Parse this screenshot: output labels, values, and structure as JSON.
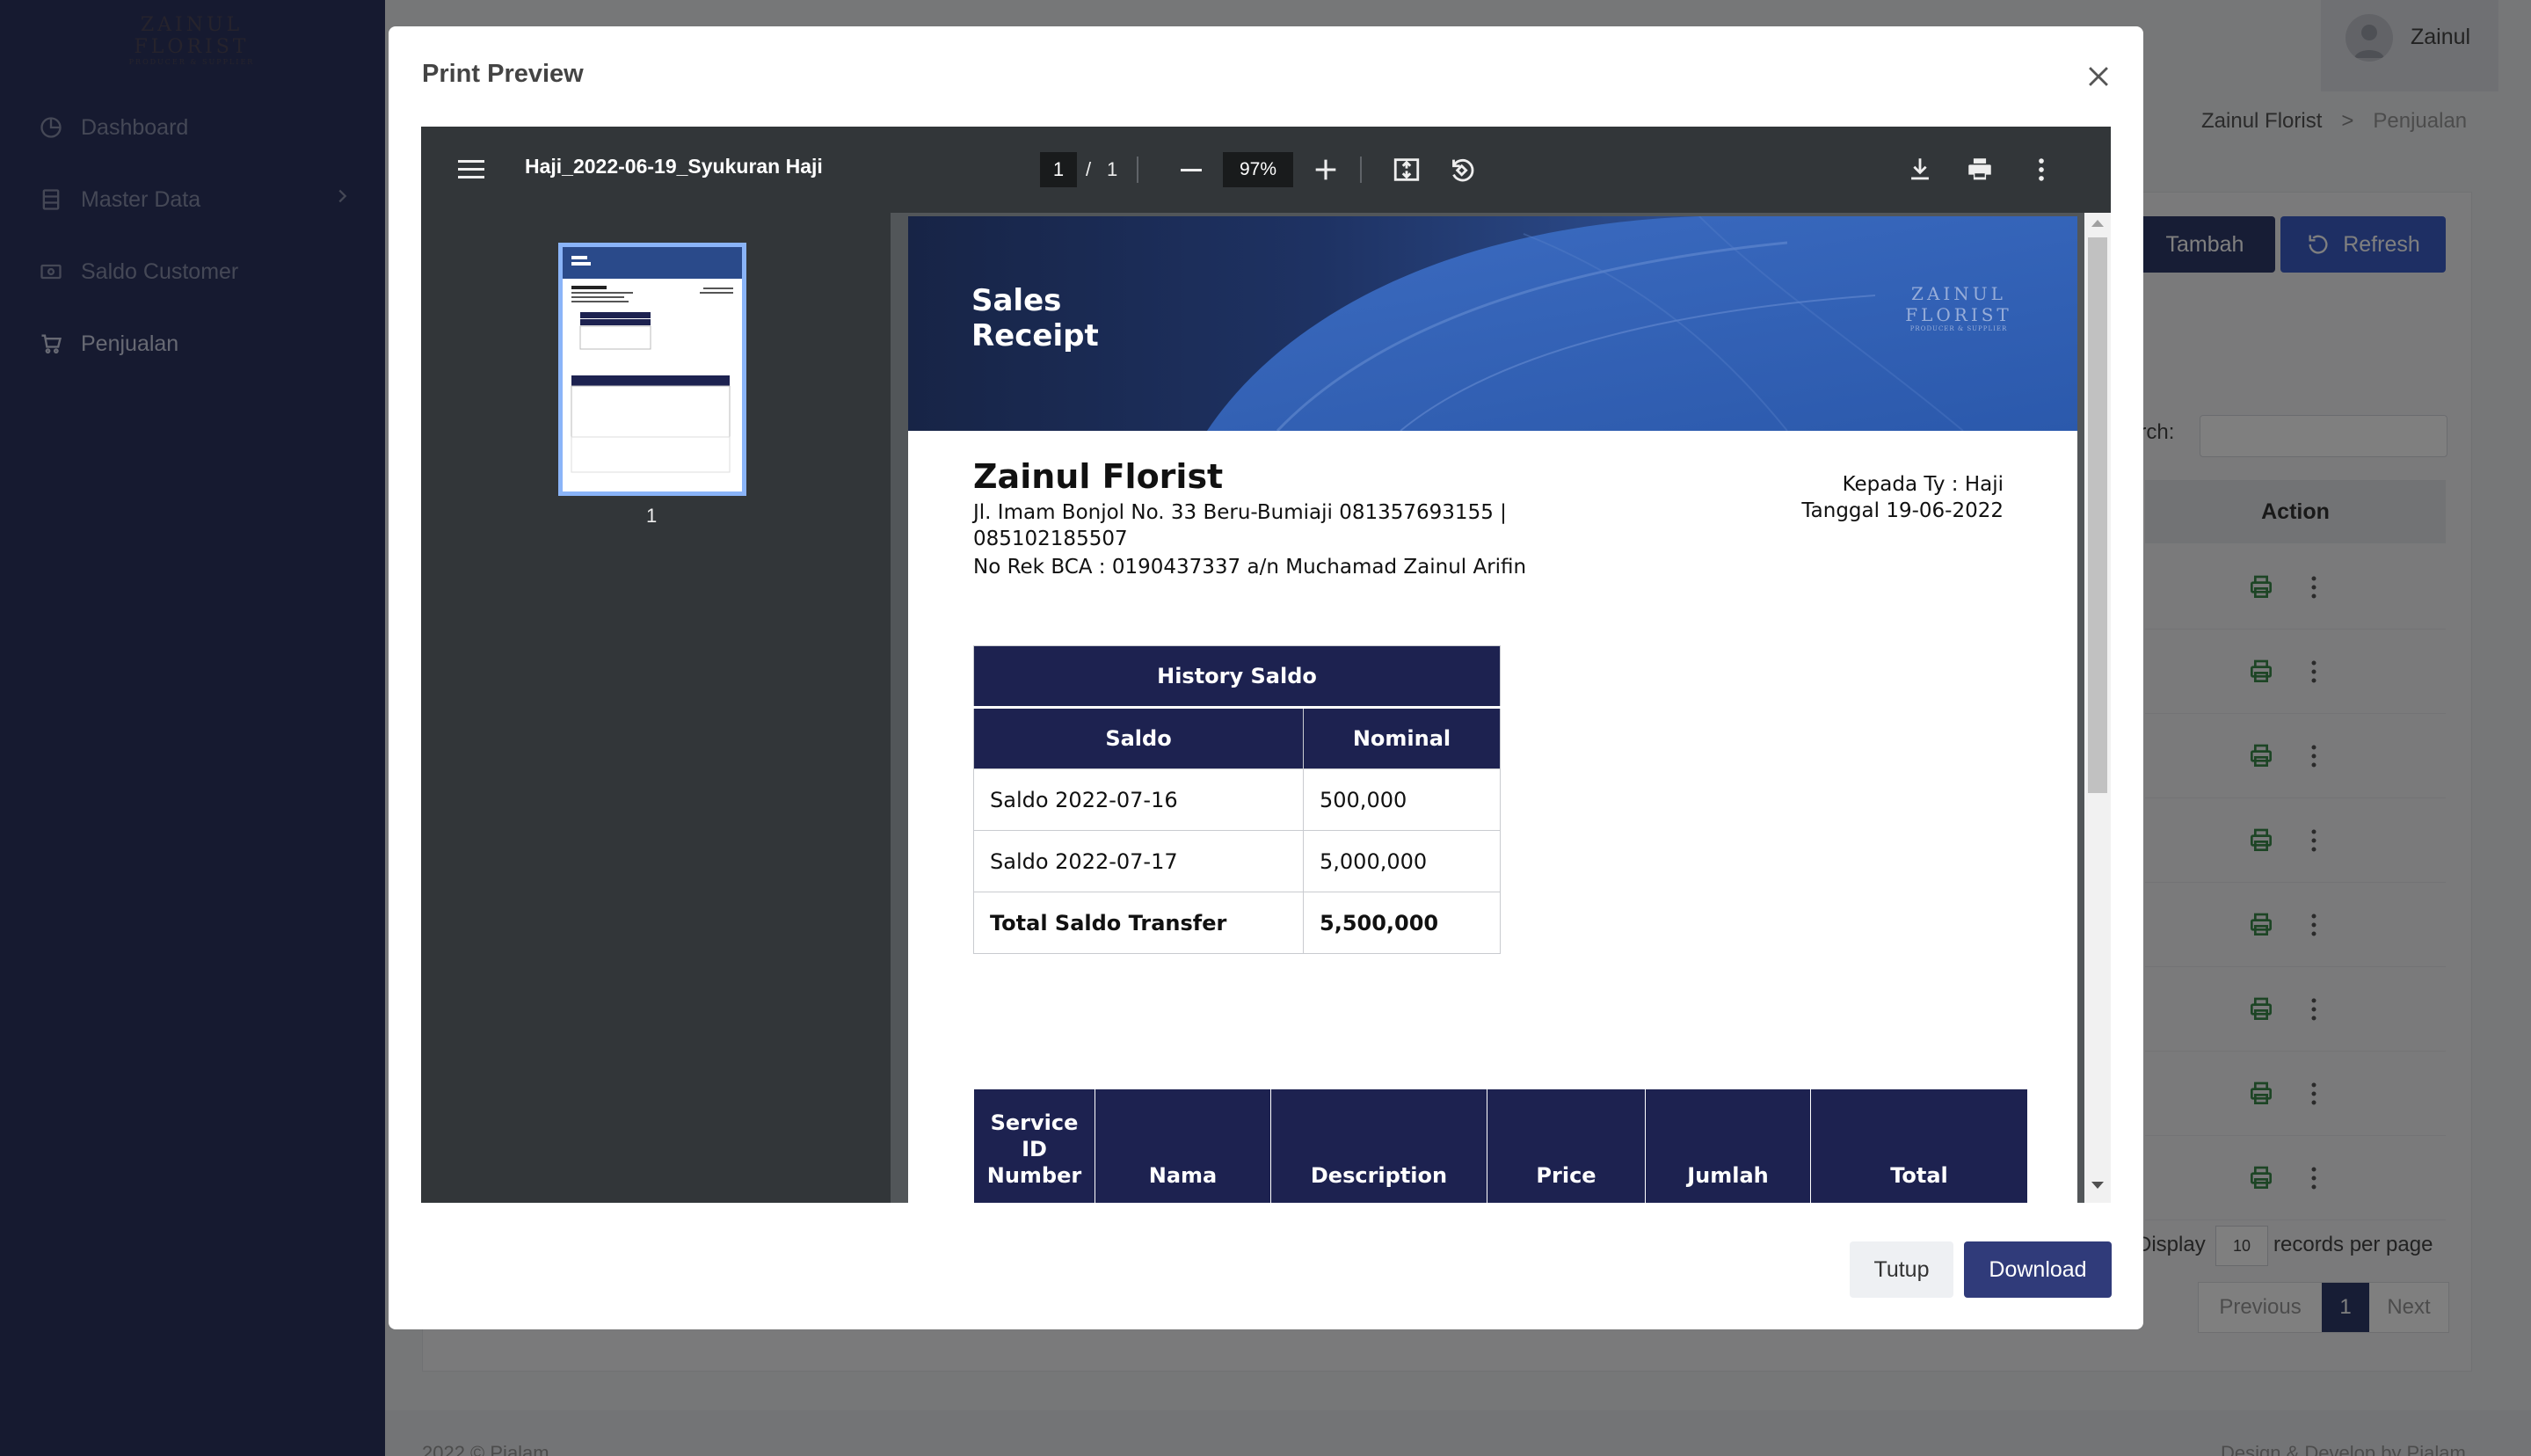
{
  "app": {
    "logo": {
      "line1": "ZAINUL",
      "line2": "FLORIST",
      "line3": "PRODUCER & SUPPLIER"
    },
    "sidebar": {
      "items": [
        {
          "label": "Dashboard",
          "icon": "dashboard-icon"
        },
        {
          "label": "Master Data",
          "icon": "database-icon"
        },
        {
          "label": "Saldo Customer",
          "icon": "wallet-icon"
        },
        {
          "label": "Penjualan",
          "icon": "cart-icon"
        }
      ]
    },
    "user": {
      "name": "Zainul"
    },
    "breadcrumb": {
      "root": "Zainul Florist",
      "sep": ">",
      "current": "Penjualan"
    },
    "toolbar": {
      "add_label": "Tambah",
      "refresh_label": "Refresh"
    },
    "search": {
      "label": "arch:",
      "value": ""
    },
    "table": {
      "action_header": "Action",
      "row_count": 8
    },
    "pagination": {
      "display_label": "Display",
      "page_size": "10",
      "suffix": "records per page",
      "previous": "Previous",
      "current": "1",
      "next": "Next"
    },
    "footer": {
      "left": "2022 © Pialam",
      "right": "Design & Develop by Pialam"
    }
  },
  "modal": {
    "title": "Print Preview",
    "viewer": {
      "filename": "Haji_2022-06-19_Syukuran Haji",
      "page": "1",
      "separator": "/",
      "total_pages": "1",
      "zoom": "97%",
      "thumbnail_label": "1"
    },
    "receipt": {
      "banner_title_1": "Sales",
      "banner_title_2": "Receipt",
      "banner_logo_1": "ZAINUL",
      "banner_logo_2": "FLORIST",
      "banner_logo_3": "PRODUCER & SUPPLIER",
      "company": "Zainul Florist",
      "address": "Jl. Imam Bonjol No. 33 Beru-Bumiaji 081357693155 | 085102185507",
      "bank": "No Rek BCA : 0190437337 a/n Muchamad Zainul Arifin",
      "to": "Kepada Ty : Haji",
      "date": "Tanggal 19-06-2022",
      "history": {
        "title": "History Saldo",
        "col_saldo": "Saldo",
        "col_nominal": "Nominal",
        "rows": [
          {
            "saldo": "Saldo 2022-07-16",
            "nominal": "500,000"
          },
          {
            "saldo": "Saldo 2022-07-17",
            "nominal": "5,000,000"
          }
        ],
        "total_label": "Total Saldo Transfer",
        "total_value": "5,500,000"
      },
      "service_headers": [
        "Service ID Number",
        "Nama",
        "Description",
        "Price",
        "Jumlah",
        "Total"
      ]
    },
    "buttons": {
      "close": "Tutup",
      "download": "Download"
    }
  },
  "colors": {
    "sidebar": "#2c3560",
    "primary": "#303b7a",
    "refresh": "#3d5fc9",
    "table_header": "#1d2250",
    "viewer_toolbar": "#323639"
  }
}
